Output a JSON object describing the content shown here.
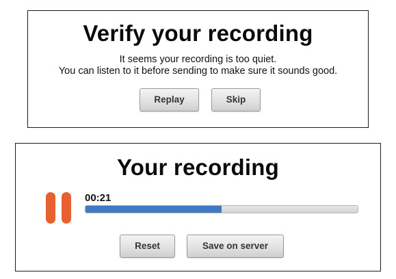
{
  "verify_dialog": {
    "title": "Verify your recording",
    "message_line_1": "It seems your recording is too quiet.",
    "message_line_2": "You can listen to it before sending to make sure it sounds good.",
    "replay_label": "Replay",
    "skip_label": "Skip"
  },
  "recording_panel": {
    "title": "Your recording",
    "timer": "00:21",
    "progress_fraction": 0.5,
    "pause_icon": "pause-icon",
    "reset_label": "Reset",
    "save_label": "Save on server"
  },
  "colors": {
    "pause_accent": "#e6612e",
    "progress_fill": "#3f79c4",
    "progress_track": "#dcdcdc"
  }
}
